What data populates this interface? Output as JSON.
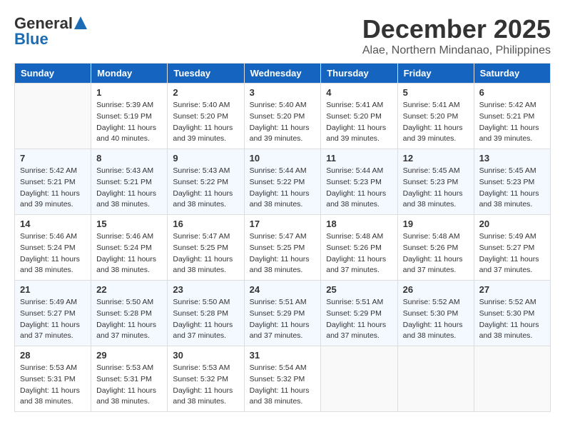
{
  "logo": {
    "line1": "General",
    "line2": "Blue"
  },
  "title": "December 2025",
  "subtitle": "Alae, Northern Mindanao, Philippines",
  "headers": [
    "Sunday",
    "Monday",
    "Tuesday",
    "Wednesday",
    "Thursday",
    "Friday",
    "Saturday"
  ],
  "weeks": [
    [
      {
        "day": "",
        "sunrise": "",
        "sunset": "",
        "daylight": ""
      },
      {
        "day": "1",
        "sunrise": "Sunrise: 5:39 AM",
        "sunset": "Sunset: 5:19 PM",
        "daylight": "Daylight: 11 hours and 40 minutes."
      },
      {
        "day": "2",
        "sunrise": "Sunrise: 5:40 AM",
        "sunset": "Sunset: 5:20 PM",
        "daylight": "Daylight: 11 hours and 39 minutes."
      },
      {
        "day": "3",
        "sunrise": "Sunrise: 5:40 AM",
        "sunset": "Sunset: 5:20 PM",
        "daylight": "Daylight: 11 hours and 39 minutes."
      },
      {
        "day": "4",
        "sunrise": "Sunrise: 5:41 AM",
        "sunset": "Sunset: 5:20 PM",
        "daylight": "Daylight: 11 hours and 39 minutes."
      },
      {
        "day": "5",
        "sunrise": "Sunrise: 5:41 AM",
        "sunset": "Sunset: 5:20 PM",
        "daylight": "Daylight: 11 hours and 39 minutes."
      },
      {
        "day": "6",
        "sunrise": "Sunrise: 5:42 AM",
        "sunset": "Sunset: 5:21 PM",
        "daylight": "Daylight: 11 hours and 39 minutes."
      }
    ],
    [
      {
        "day": "7",
        "sunrise": "Sunrise: 5:42 AM",
        "sunset": "Sunset: 5:21 PM",
        "daylight": "Daylight: 11 hours and 39 minutes."
      },
      {
        "day": "8",
        "sunrise": "Sunrise: 5:43 AM",
        "sunset": "Sunset: 5:21 PM",
        "daylight": "Daylight: 11 hours and 38 minutes."
      },
      {
        "day": "9",
        "sunrise": "Sunrise: 5:43 AM",
        "sunset": "Sunset: 5:22 PM",
        "daylight": "Daylight: 11 hours and 38 minutes."
      },
      {
        "day": "10",
        "sunrise": "Sunrise: 5:44 AM",
        "sunset": "Sunset: 5:22 PM",
        "daylight": "Daylight: 11 hours and 38 minutes."
      },
      {
        "day": "11",
        "sunrise": "Sunrise: 5:44 AM",
        "sunset": "Sunset: 5:23 PM",
        "daylight": "Daylight: 11 hours and 38 minutes."
      },
      {
        "day": "12",
        "sunrise": "Sunrise: 5:45 AM",
        "sunset": "Sunset: 5:23 PM",
        "daylight": "Daylight: 11 hours and 38 minutes."
      },
      {
        "day": "13",
        "sunrise": "Sunrise: 5:45 AM",
        "sunset": "Sunset: 5:23 PM",
        "daylight": "Daylight: 11 hours and 38 minutes."
      }
    ],
    [
      {
        "day": "14",
        "sunrise": "Sunrise: 5:46 AM",
        "sunset": "Sunset: 5:24 PM",
        "daylight": "Daylight: 11 hours and 38 minutes."
      },
      {
        "day": "15",
        "sunrise": "Sunrise: 5:46 AM",
        "sunset": "Sunset: 5:24 PM",
        "daylight": "Daylight: 11 hours and 38 minutes."
      },
      {
        "day": "16",
        "sunrise": "Sunrise: 5:47 AM",
        "sunset": "Sunset: 5:25 PM",
        "daylight": "Daylight: 11 hours and 38 minutes."
      },
      {
        "day": "17",
        "sunrise": "Sunrise: 5:47 AM",
        "sunset": "Sunset: 5:25 PM",
        "daylight": "Daylight: 11 hours and 38 minutes."
      },
      {
        "day": "18",
        "sunrise": "Sunrise: 5:48 AM",
        "sunset": "Sunset: 5:26 PM",
        "daylight": "Daylight: 11 hours and 37 minutes."
      },
      {
        "day": "19",
        "sunrise": "Sunrise: 5:48 AM",
        "sunset": "Sunset: 5:26 PM",
        "daylight": "Daylight: 11 hours and 37 minutes."
      },
      {
        "day": "20",
        "sunrise": "Sunrise: 5:49 AM",
        "sunset": "Sunset: 5:27 PM",
        "daylight": "Daylight: 11 hours and 37 minutes."
      }
    ],
    [
      {
        "day": "21",
        "sunrise": "Sunrise: 5:49 AM",
        "sunset": "Sunset: 5:27 PM",
        "daylight": "Daylight: 11 hours and 37 minutes."
      },
      {
        "day": "22",
        "sunrise": "Sunrise: 5:50 AM",
        "sunset": "Sunset: 5:28 PM",
        "daylight": "Daylight: 11 hours and 37 minutes."
      },
      {
        "day": "23",
        "sunrise": "Sunrise: 5:50 AM",
        "sunset": "Sunset: 5:28 PM",
        "daylight": "Daylight: 11 hours and 37 minutes."
      },
      {
        "day": "24",
        "sunrise": "Sunrise: 5:51 AM",
        "sunset": "Sunset: 5:29 PM",
        "daylight": "Daylight: 11 hours and 37 minutes."
      },
      {
        "day": "25",
        "sunrise": "Sunrise: 5:51 AM",
        "sunset": "Sunset: 5:29 PM",
        "daylight": "Daylight: 11 hours and 37 minutes."
      },
      {
        "day": "26",
        "sunrise": "Sunrise: 5:52 AM",
        "sunset": "Sunset: 5:30 PM",
        "daylight": "Daylight: 11 hours and 38 minutes."
      },
      {
        "day": "27",
        "sunrise": "Sunrise: 5:52 AM",
        "sunset": "Sunset: 5:30 PM",
        "daylight": "Daylight: 11 hours and 38 minutes."
      }
    ],
    [
      {
        "day": "28",
        "sunrise": "Sunrise: 5:53 AM",
        "sunset": "Sunset: 5:31 PM",
        "daylight": "Daylight: 11 hours and 38 minutes."
      },
      {
        "day": "29",
        "sunrise": "Sunrise: 5:53 AM",
        "sunset": "Sunset: 5:31 PM",
        "daylight": "Daylight: 11 hours and 38 minutes."
      },
      {
        "day": "30",
        "sunrise": "Sunrise: 5:53 AM",
        "sunset": "Sunset: 5:32 PM",
        "daylight": "Daylight: 11 hours and 38 minutes."
      },
      {
        "day": "31",
        "sunrise": "Sunrise: 5:54 AM",
        "sunset": "Sunset: 5:32 PM",
        "daylight": "Daylight: 11 hours and 38 minutes."
      },
      {
        "day": "",
        "sunrise": "",
        "sunset": "",
        "daylight": ""
      },
      {
        "day": "",
        "sunrise": "",
        "sunset": "",
        "daylight": ""
      },
      {
        "day": "",
        "sunrise": "",
        "sunset": "",
        "daylight": ""
      }
    ]
  ]
}
